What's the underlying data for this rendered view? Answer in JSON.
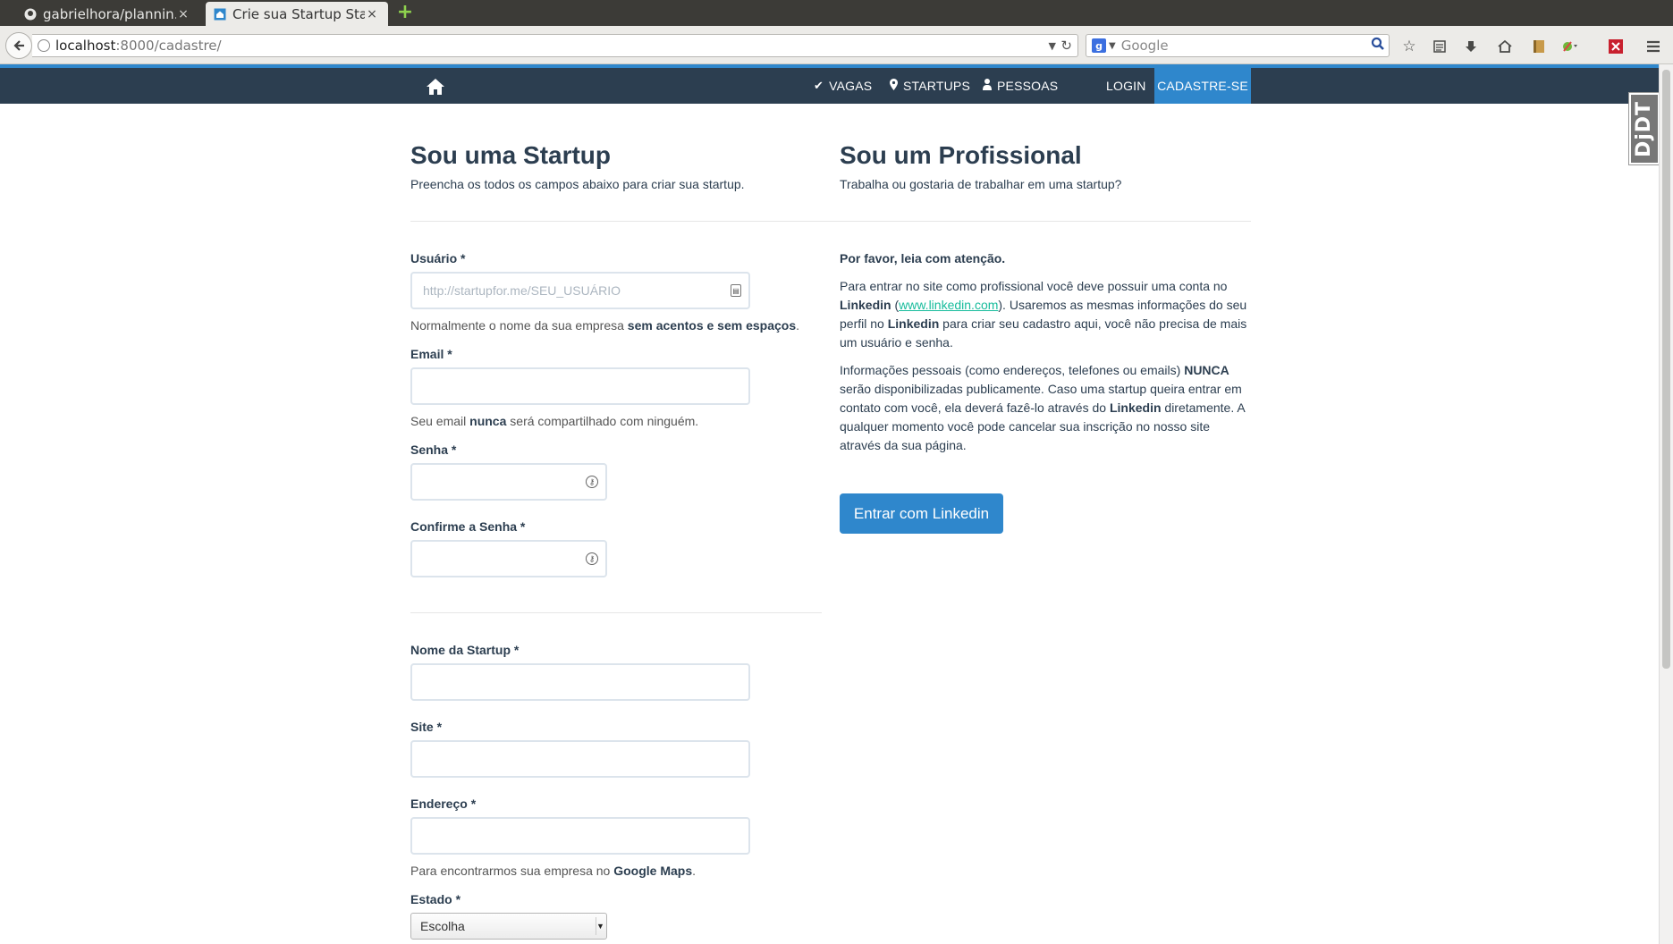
{
  "browser": {
    "tabs": [
      {
        "title": "gabrielhora/plannin…",
        "close": "×"
      },
      {
        "title": "Crie sua Startup Sta…",
        "close": "×"
      }
    ],
    "new_tab": "+",
    "url_host": "localhost",
    "url_path": ":8000/cadastre/",
    "search_placeholder": "Google",
    "search_engine_letter": "g"
  },
  "nav": {
    "items": [
      {
        "icon": "check-icon",
        "label": "VAGAS"
      },
      {
        "icon": "map-marker-icon",
        "label": "STARTUPS"
      },
      {
        "icon": "user-icon",
        "label": "PESSOAS"
      }
    ],
    "login": "LOGIN",
    "cadastre": "CADASTRE-SE",
    "accent": "#2f87cc",
    "bg": "#2c3e50"
  },
  "startup": {
    "title": "Sou uma Startup",
    "subtitle": "Preencha os todos os campos abaixo para criar sua startup.",
    "usuario": {
      "label": "Usuário *",
      "placeholder": "http://startupfor.me/SEU_USUÁRIO",
      "help_pre": "Normalmente o nome da sua empresa ",
      "help_bold": "sem acentos e sem espaços",
      "help_post": "."
    },
    "email": {
      "label": "Email *",
      "value": "",
      "help_pre": "Seu email ",
      "help_bold": "nunca",
      "help_post": " será compartilhado com ninguém."
    },
    "senha": {
      "label": "Senha *",
      "value": ""
    },
    "confirme": {
      "label": "Confirme a Senha *",
      "value": ""
    },
    "nome": {
      "label": "Nome da Startup *",
      "value": ""
    },
    "site": {
      "label": "Site *",
      "value": ""
    },
    "endereco": {
      "label": "Endereço *",
      "value": "",
      "help_pre": "Para encontrarmos sua empresa no ",
      "help_bold": "Google Maps",
      "help_post": "."
    },
    "estado": {
      "label": "Estado *",
      "selected": "Escolha"
    }
  },
  "profissional": {
    "title": "Sou um Profissional",
    "subtitle": "Trabalha ou gostaria de trabalhar em uma startup?",
    "notice": "Por favor, leia com atenção.",
    "p1": {
      "t1": "Para entrar no site como profissional você deve possuir uma conta no ",
      "b1": "Linkedin",
      "t2": " (",
      "link": "www.linkedin.com",
      "t3": "). Usaremos as mesmas informações do seu perfil no ",
      "b2": "Linkedin",
      "t4": " para criar seu cadastro aqui, você não precisa de mais um usuário e senha."
    },
    "p2": {
      "t1": "Informações pessoais (como endereços, telefones ou emails) ",
      "b1": "NUNCA",
      "t2": " serão disponibilizadas publicamente. Caso uma startup queira entrar em contato com você, ela deverá fazê-lo através do ",
      "b2": "Linkedin",
      "t3": " diretamente. A qualquer momento você pode cancelar sua inscrição no nosso site através da sua página."
    },
    "button": "Entrar com Linkedin"
  },
  "side_tab": "DjDT"
}
